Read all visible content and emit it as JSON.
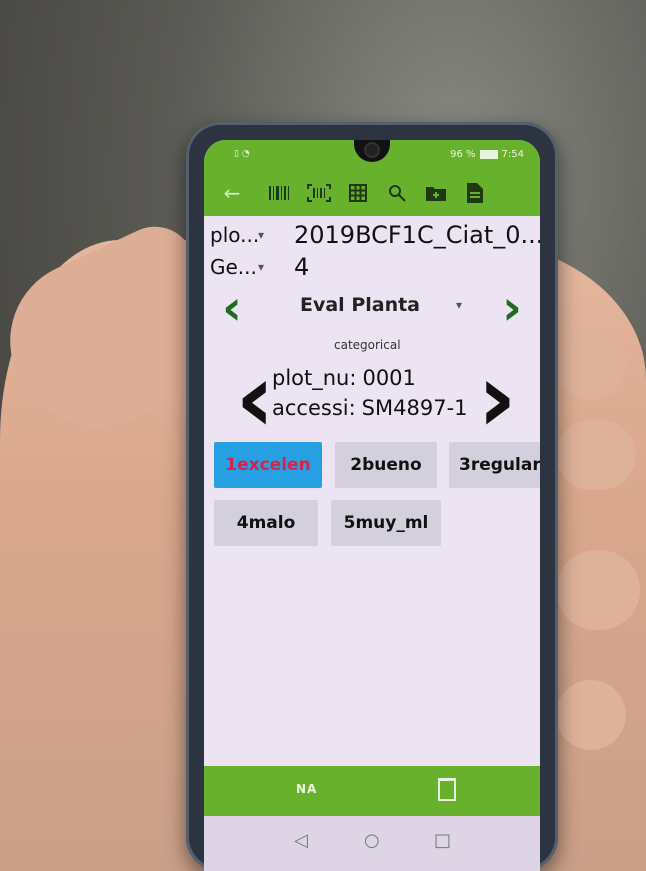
{
  "status_bar": {
    "left_icons": "▯ ◔",
    "battery_percent": "96 %",
    "time": "7:54"
  },
  "toolbar": {
    "icons": [
      "back-arrow-icon",
      "barcode-icon",
      "barcode-scan-icon",
      "grid-icon",
      "search-icon",
      "folder-add-icon",
      "document-icon"
    ]
  },
  "info_bars": [
    {
      "key": "plo...",
      "value": "2019BCF1C_Ciat_0..."
    },
    {
      "key": "Ge...",
      "value": "4"
    }
  ],
  "trait": {
    "name": "Eval Planta",
    "type": "categorical"
  },
  "entry": {
    "fields": [
      {
        "key": "plot_nu:",
        "value": "0001"
      },
      {
        "key": "accessi:",
        "value": "SM4897-1"
      }
    ]
  },
  "categories": [
    {
      "label": "1excelen",
      "selected": true
    },
    {
      "label": "2bueno",
      "selected": false
    },
    {
      "label": "3regular",
      "selected": false
    },
    {
      "label": "4malo",
      "selected": false
    },
    {
      "label": "5muy_ml",
      "selected": false
    }
  ],
  "bottom_bar": {
    "na_label": "NA"
  },
  "colors": {
    "toolbar": "#67b12d",
    "selected_bg": "#26a0e3",
    "selected_text": "#d4244a",
    "nav_arrow": "#1f6b1f"
  }
}
